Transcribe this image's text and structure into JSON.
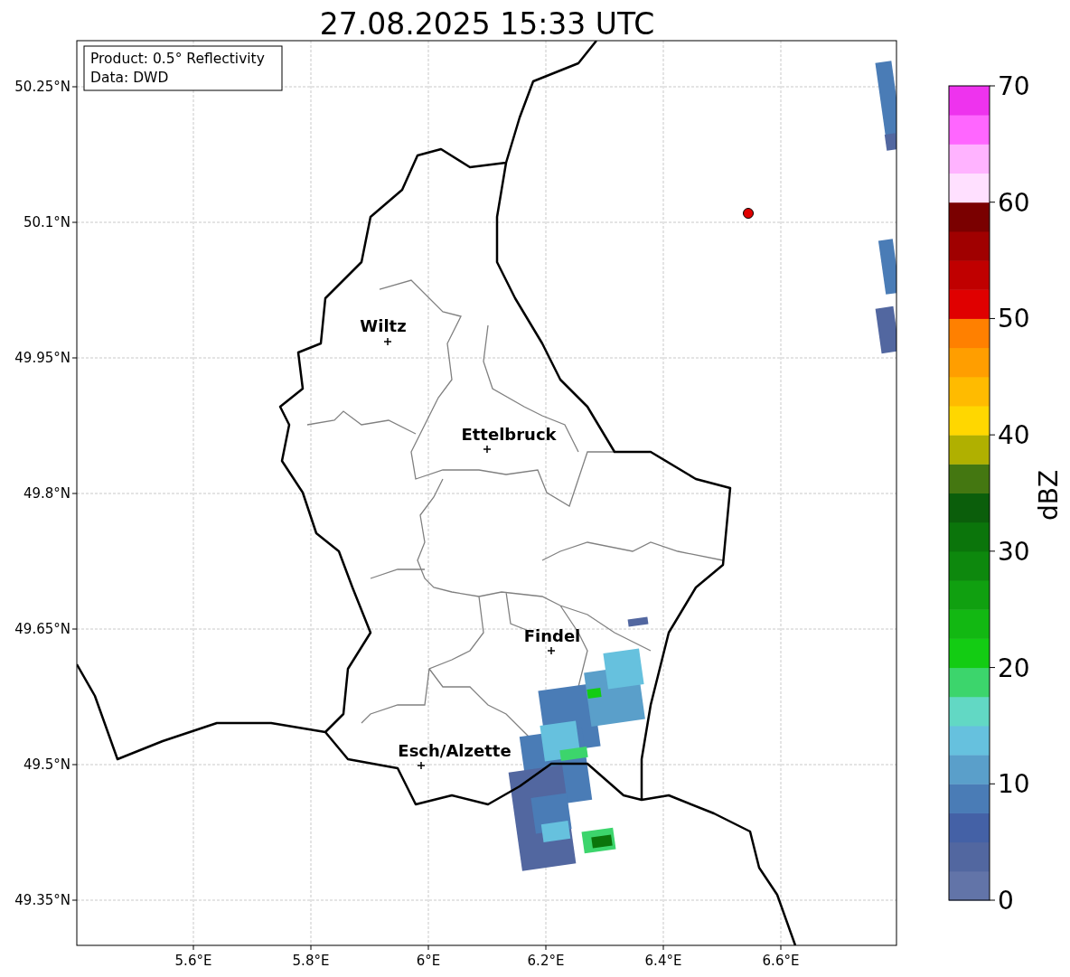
{
  "title": "27.08.2025 15:33 UTC",
  "info_box": [
    "Product: 0.5° Reflectivity",
    "Data: DWD"
  ],
  "y_ticks": [
    "50.25°N",
    "50.1°N",
    "49.95°N",
    "49.8°N",
    "49.65°N",
    "49.5°N",
    "49.35°N"
  ],
  "x_ticks": [
    "5.6°E",
    "5.8°E",
    "6°E",
    "6.2°E",
    "6.4°E",
    "6.6°E"
  ],
  "cities": [
    {
      "name": "Wiltz"
    },
    {
      "name": "Ettelbruck"
    },
    {
      "name": "Findel"
    },
    {
      "name": "Esch/Alzette"
    }
  ],
  "colorbar": {
    "label": "dBZ",
    "ticks": [
      "70",
      "60",
      "50",
      "40",
      "30",
      "20",
      "10",
      "0"
    ],
    "bands": [
      {
        "color": "#6274a8"
      },
      {
        "color": "#5267a0"
      },
      {
        "color": "#4461a6"
      },
      {
        "color": "#4a7cb6"
      },
      {
        "color": "#5a9fca"
      },
      {
        "color": "#66c1de"
      },
      {
        "color": "#62d8c4"
      },
      {
        "color": "#3cd56c"
      },
      {
        "color": "#13cc13"
      },
      {
        "color": "#12b812"
      },
      {
        "color": "#10a010"
      },
      {
        "color": "#0d880d"
      },
      {
        "color": "#0b750b"
      },
      {
        "color": "#0b5e0b"
      },
      {
        "color": "#447711"
      },
      {
        "color": "#b0b000"
      },
      {
        "color": "#ffd700"
      },
      {
        "color": "#ffbb00"
      },
      {
        "color": "#ff9e00"
      },
      {
        "color": "#ff8000"
      },
      {
        "color": "#e00000"
      },
      {
        "color": "#c00000"
      },
      {
        "color": "#a00000"
      },
      {
        "color": "#7a0000"
      },
      {
        "color": "#ffe0ff"
      },
      {
        "color": "#ffb3ff"
      },
      {
        "color": "#ff66ff"
      },
      {
        "color": "#ee33ee"
      }
    ]
  }
}
